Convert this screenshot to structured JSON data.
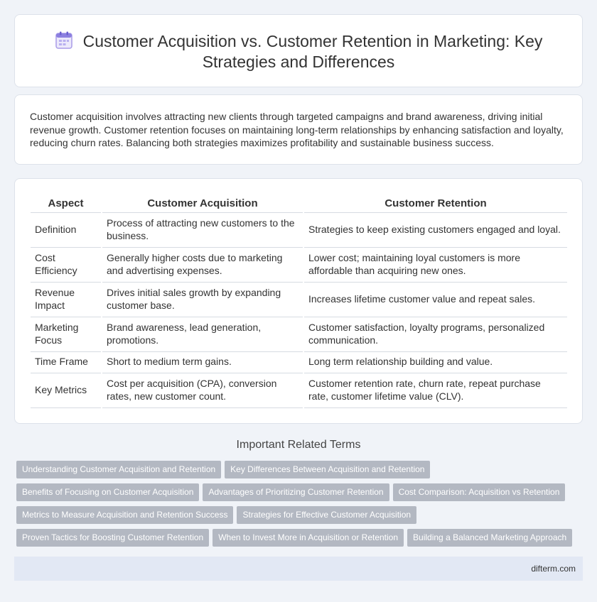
{
  "header": {
    "title": "Customer Acquisition vs. Customer Retention in Marketing: Key Strategies and Differences",
    "icon": "document-icon"
  },
  "intro": {
    "text": "Customer acquisition involves attracting new clients through targeted campaigns and brand awareness, driving initial revenue growth. Customer retention focuses on maintaining long-term relationships by enhancing satisfaction and loyalty, reducing churn rates. Balancing both strategies maximizes profitability and sustainable business success."
  },
  "comparison_table": {
    "headers": [
      "Aspect",
      "Customer Acquisition",
      "Customer Retention"
    ],
    "rows": [
      [
        "Definition",
        "Process of attracting new customers to the business.",
        "Strategies to keep existing customers engaged and loyal."
      ],
      [
        "Cost Efficiency",
        "Generally higher costs due to marketing and advertising expenses.",
        "Lower cost; maintaining loyal customers is more affordable than acquiring new ones."
      ],
      [
        "Revenue Impact",
        "Drives initial sales growth by expanding customer base.",
        "Increases lifetime customer value and repeat sales."
      ],
      [
        "Marketing Focus",
        "Brand awareness, lead generation, promotions.",
        "Customer satisfaction, loyalty programs, personalized communication."
      ],
      [
        "Time Frame",
        "Short to medium term gains.",
        "Long term relationship building and value."
      ],
      [
        "Key Metrics",
        "Cost per acquisition (CPA), conversion rates, new customer count.",
        "Customer retention rate, churn rate, repeat purchase rate, customer lifetime value (CLV)."
      ]
    ]
  },
  "related": {
    "title": "Important Related Terms",
    "tags": [
      "Understanding Customer Acquisition and Retention",
      "Key Differences Between Acquisition and Retention",
      "Benefits of Focusing on Customer Acquisition",
      "Advantages of Prioritizing Customer Retention",
      "Cost Comparison: Acquisition vs Retention",
      "Metrics to Measure Acquisition and Retention Success",
      "Strategies for Effective Customer Acquisition",
      "Proven Tactics for Boosting Customer Retention",
      "When to Invest More in Acquisition or Retention",
      "Building a Balanced Marketing Approach"
    ]
  },
  "footer": {
    "site": "difterm.com"
  },
  "colors": {
    "background": "#f0f3f8",
    "tag": "#b3b8c2",
    "footer": "#e2e8f4",
    "icon": "#7b6fd6"
  }
}
